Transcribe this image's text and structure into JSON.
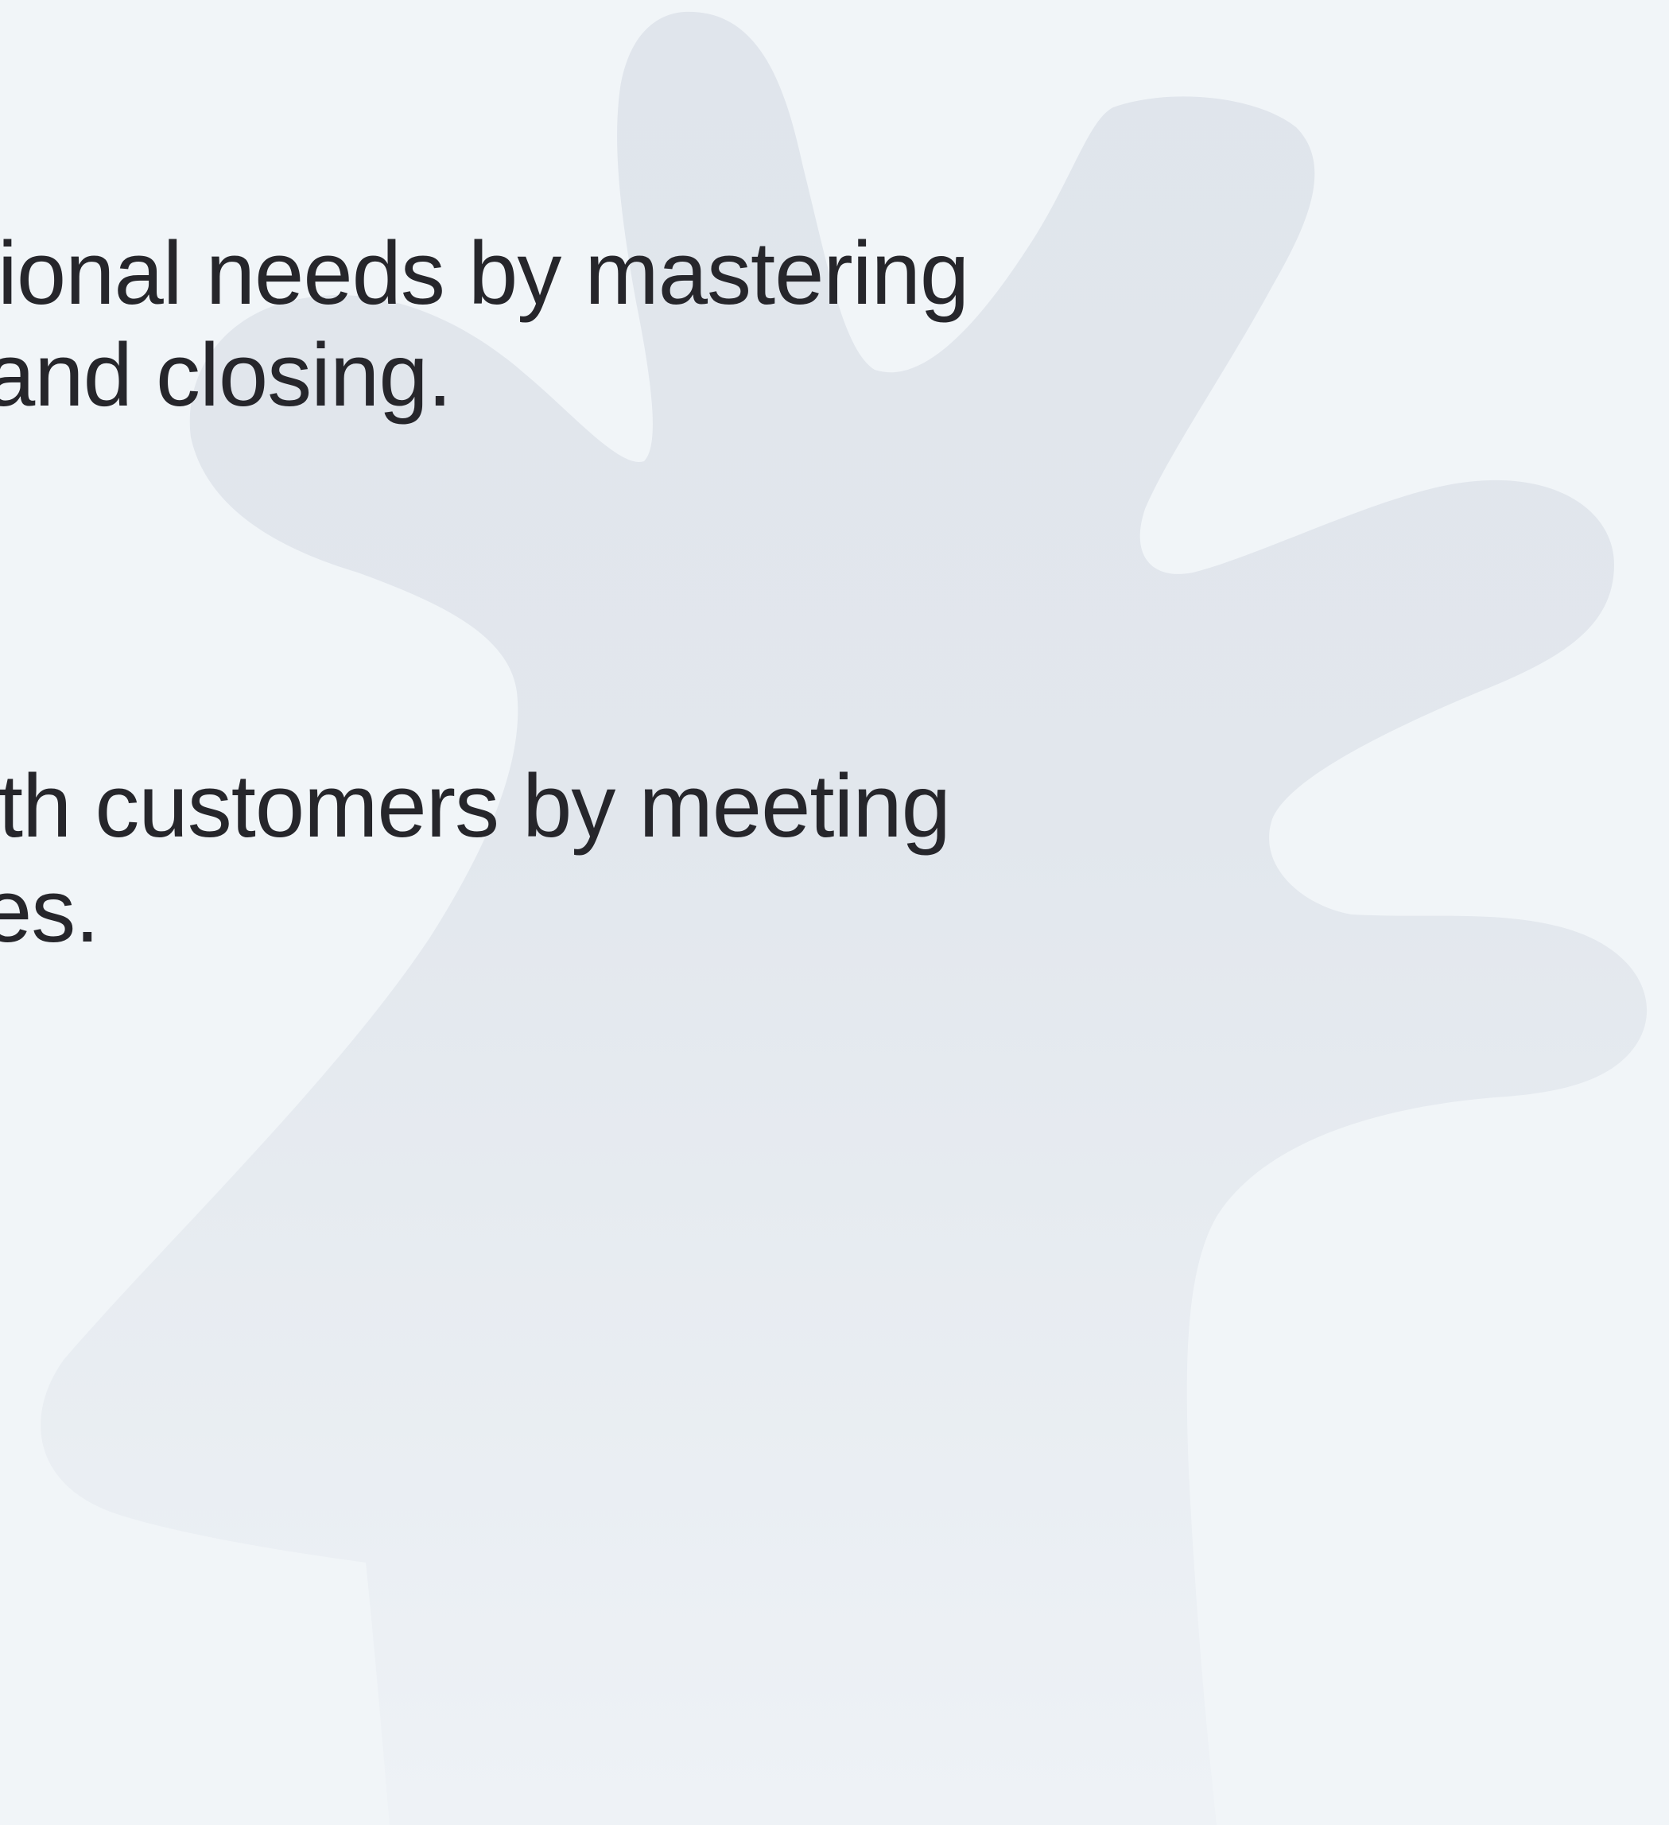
{
  "background": {
    "color": "#f1f5f8",
    "shape_color": "#e0e5ec",
    "shape_icon": "hand-silhouette-icon"
  },
  "content": {
    "paragraph_1": {
      "line_1": "sional needs by mastering",
      "line_2": "and closing."
    },
    "paragraph_2": {
      "line_1": "ith customers by meeting",
      "line_2": "es."
    }
  },
  "colors": {
    "text": "#26262b"
  }
}
